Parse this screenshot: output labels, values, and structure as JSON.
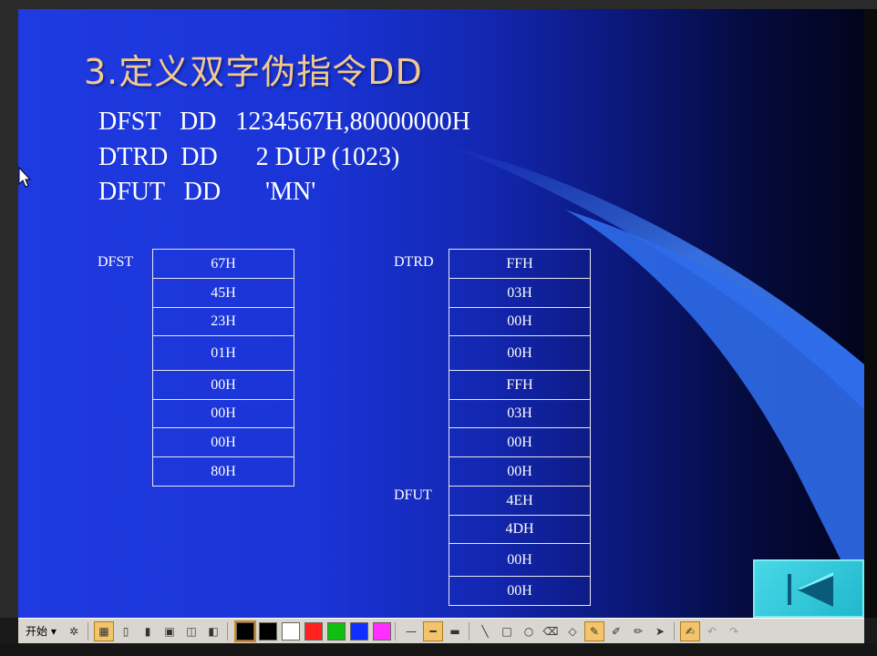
{
  "slide": {
    "title": "3.定义双字伪指令DD",
    "code_lines": [
      "DFST   DD   1234567H,80000000H",
      "DTRD  DD      2 DUP (1023)",
      "DFUT   DD       'MN'"
    ]
  },
  "memory": {
    "dfst": {
      "label": "DFST",
      "cells": [
        "67H",
        "45H",
        "23H",
        "01H",
        "00H",
        "00H",
        "00H",
        "80H"
      ]
    },
    "dtrd": {
      "label": "DTRD",
      "cells": [
        "FFH",
        "03H",
        "00H",
        "00H",
        "FFH",
        "03H",
        "00H",
        "00H"
      ]
    },
    "dfut": {
      "label": "DFUT",
      "cells": [
        "4EH",
        "4DH",
        "00H",
        "00H"
      ]
    }
  },
  "toolbar": {
    "start_label": "开始 ▾",
    "colors": [
      "#000000",
      "#000000",
      "#ffffff",
      "#ff2020",
      "#10c010",
      "#1030ff",
      "#ff30ff"
    ]
  },
  "icons": {
    "nav_back": "first-slide-icon",
    "cursor": "mouse-pointer-icon"
  }
}
